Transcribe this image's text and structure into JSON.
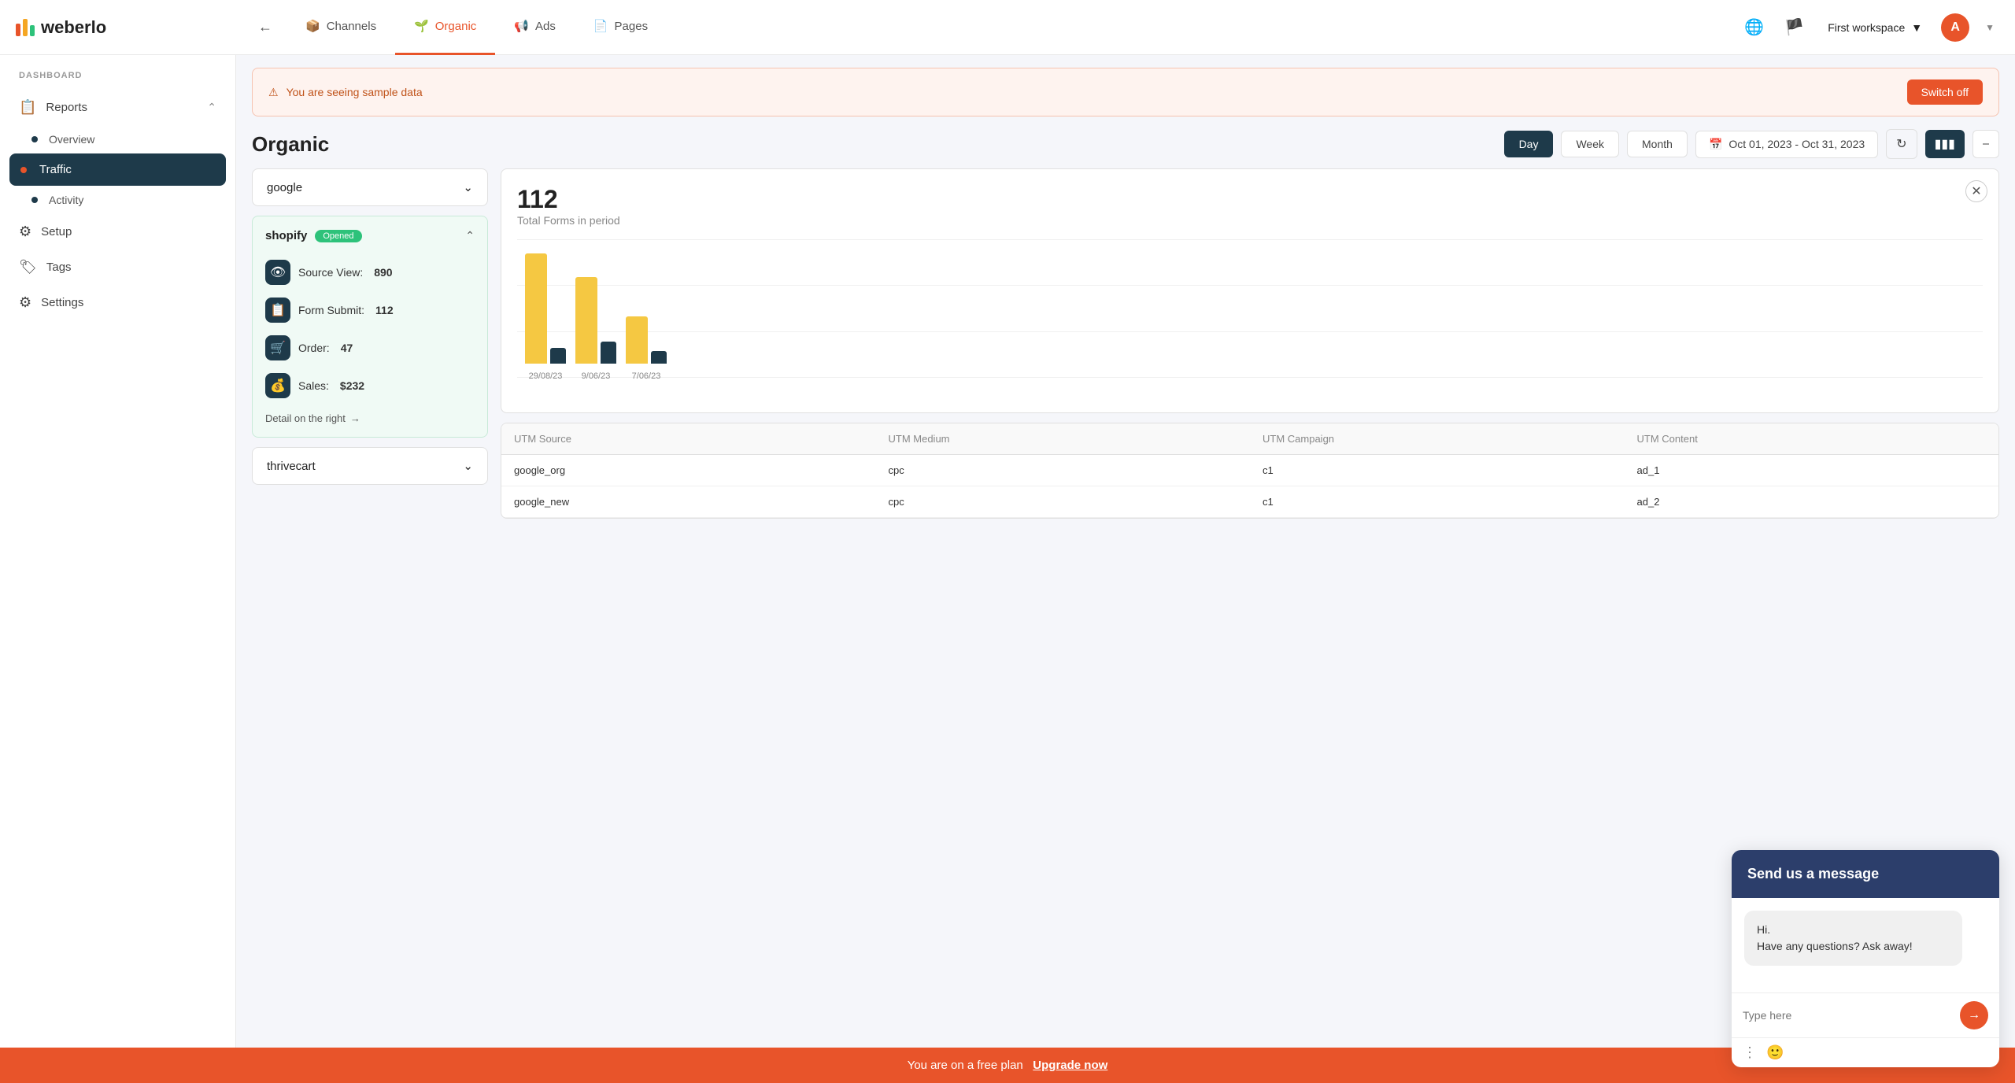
{
  "app": {
    "name": "weberlo"
  },
  "topnav": {
    "back_label": "←",
    "tabs": [
      {
        "id": "channels",
        "label": "Channels",
        "icon": "📦",
        "active": false
      },
      {
        "id": "organic",
        "label": "Organic",
        "icon": "🌱",
        "active": true
      },
      {
        "id": "ads",
        "label": "Ads",
        "icon": "📢",
        "active": false
      },
      {
        "id": "pages",
        "label": "Pages",
        "icon": "📄",
        "active": false
      }
    ],
    "workspace": "First workspace",
    "avatar_initial": "A"
  },
  "sidebar": {
    "section_label": "DASHBOARD",
    "items": [
      {
        "id": "reports",
        "label": "Reports",
        "icon": "📋",
        "has_children": true
      },
      {
        "id": "overview",
        "label": "Overview",
        "is_sub": true,
        "active": false
      },
      {
        "id": "traffic",
        "label": "Traffic",
        "is_sub": true,
        "active": true
      },
      {
        "id": "activity",
        "label": "Activity",
        "is_sub": true,
        "active": false
      },
      {
        "id": "setup",
        "label": "Setup",
        "icon": "⚙️"
      },
      {
        "id": "tags",
        "label": "Tags",
        "icon": "🏷️"
      },
      {
        "id": "settings",
        "label": "Settings",
        "icon": "⚙️"
      }
    ]
  },
  "banner": {
    "text": "You are seeing sample data",
    "button_label": "Switch off"
  },
  "organic": {
    "title": "Organic",
    "periods": [
      "Day",
      "Week",
      "Month"
    ],
    "active_period": "Day",
    "date_range": "Oct 01, 2023 - Oct 31, 2023"
  },
  "left_panel": {
    "channel_dropdown": {
      "label": "google",
      "placeholder": "google"
    },
    "shopify": {
      "title": "shopify",
      "badge": "Opened",
      "metrics": [
        {
          "id": "source-view",
          "label": "Source View:",
          "value": "890"
        },
        {
          "id": "form-submit",
          "label": "Form Submit:",
          "value": "112"
        },
        {
          "id": "order",
          "label": "Order:",
          "value": "47"
        },
        {
          "id": "sales",
          "label": "Sales:",
          "value": "$232"
        }
      ],
      "detail_link": "Detail on the right"
    },
    "thrivecart": {
      "label": "thrivecart"
    }
  },
  "chart": {
    "stat": "112",
    "label": "Total Forms in period",
    "bars": [
      {
        "date": "29/08/23",
        "yellow_height": 140,
        "dark_height": 20
      },
      {
        "date": "9/06/23",
        "yellow_height": 110,
        "dark_height": 28
      },
      {
        "date": "7/06/23",
        "yellow_height": 60,
        "dark_height": 16
      }
    ]
  },
  "table": {
    "columns": [
      "UTM Source",
      "UTM Medium",
      "UTM Campaign",
      "UTM Content"
    ],
    "rows": [
      {
        "source": "google_org",
        "medium": "cpc",
        "campaign": "c1",
        "content": "ad_1"
      },
      {
        "source": "google_new",
        "medium": "cpc",
        "campaign": "c1",
        "content": "ad_2"
      }
    ]
  },
  "chat": {
    "header": "Send us a message",
    "message": "Hi.\nHave any questions? Ask away!",
    "input_placeholder": "Type here",
    "send_icon": "→"
  },
  "bottom_banner": {
    "text": "You are on a free plan",
    "upgrade_label": "Upgrade now"
  }
}
